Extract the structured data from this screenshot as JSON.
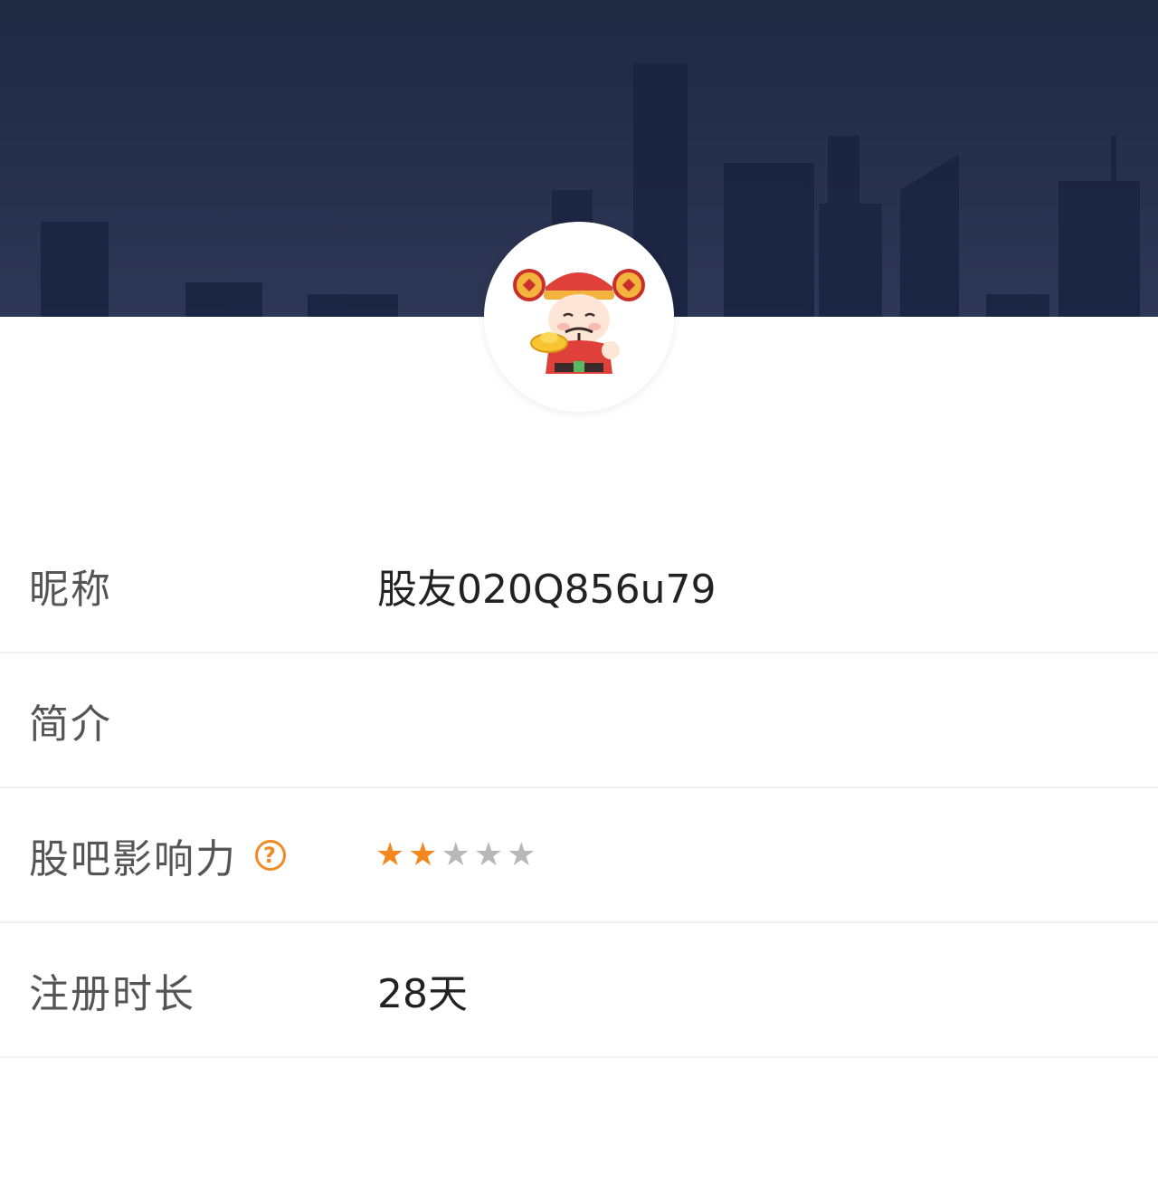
{
  "profile": {
    "avatar_icon": "cartoon-god-of-wealth-avatar",
    "fields": {
      "nickname": {
        "label": "昵称",
        "value": "股友020Q856u79"
      },
      "bio": {
        "label": "简介",
        "value": ""
      },
      "influence": {
        "label": "股吧影响力",
        "help_icon": "question-circle-icon",
        "rating": 2,
        "max_rating": 5
      },
      "registration": {
        "label": "注册时长",
        "value": "28天"
      }
    }
  },
  "colors": {
    "banner": "#27304d",
    "star_active": "#f5871f",
    "star_inactive": "#b8b8b8",
    "help_icon": "#f08a24"
  }
}
